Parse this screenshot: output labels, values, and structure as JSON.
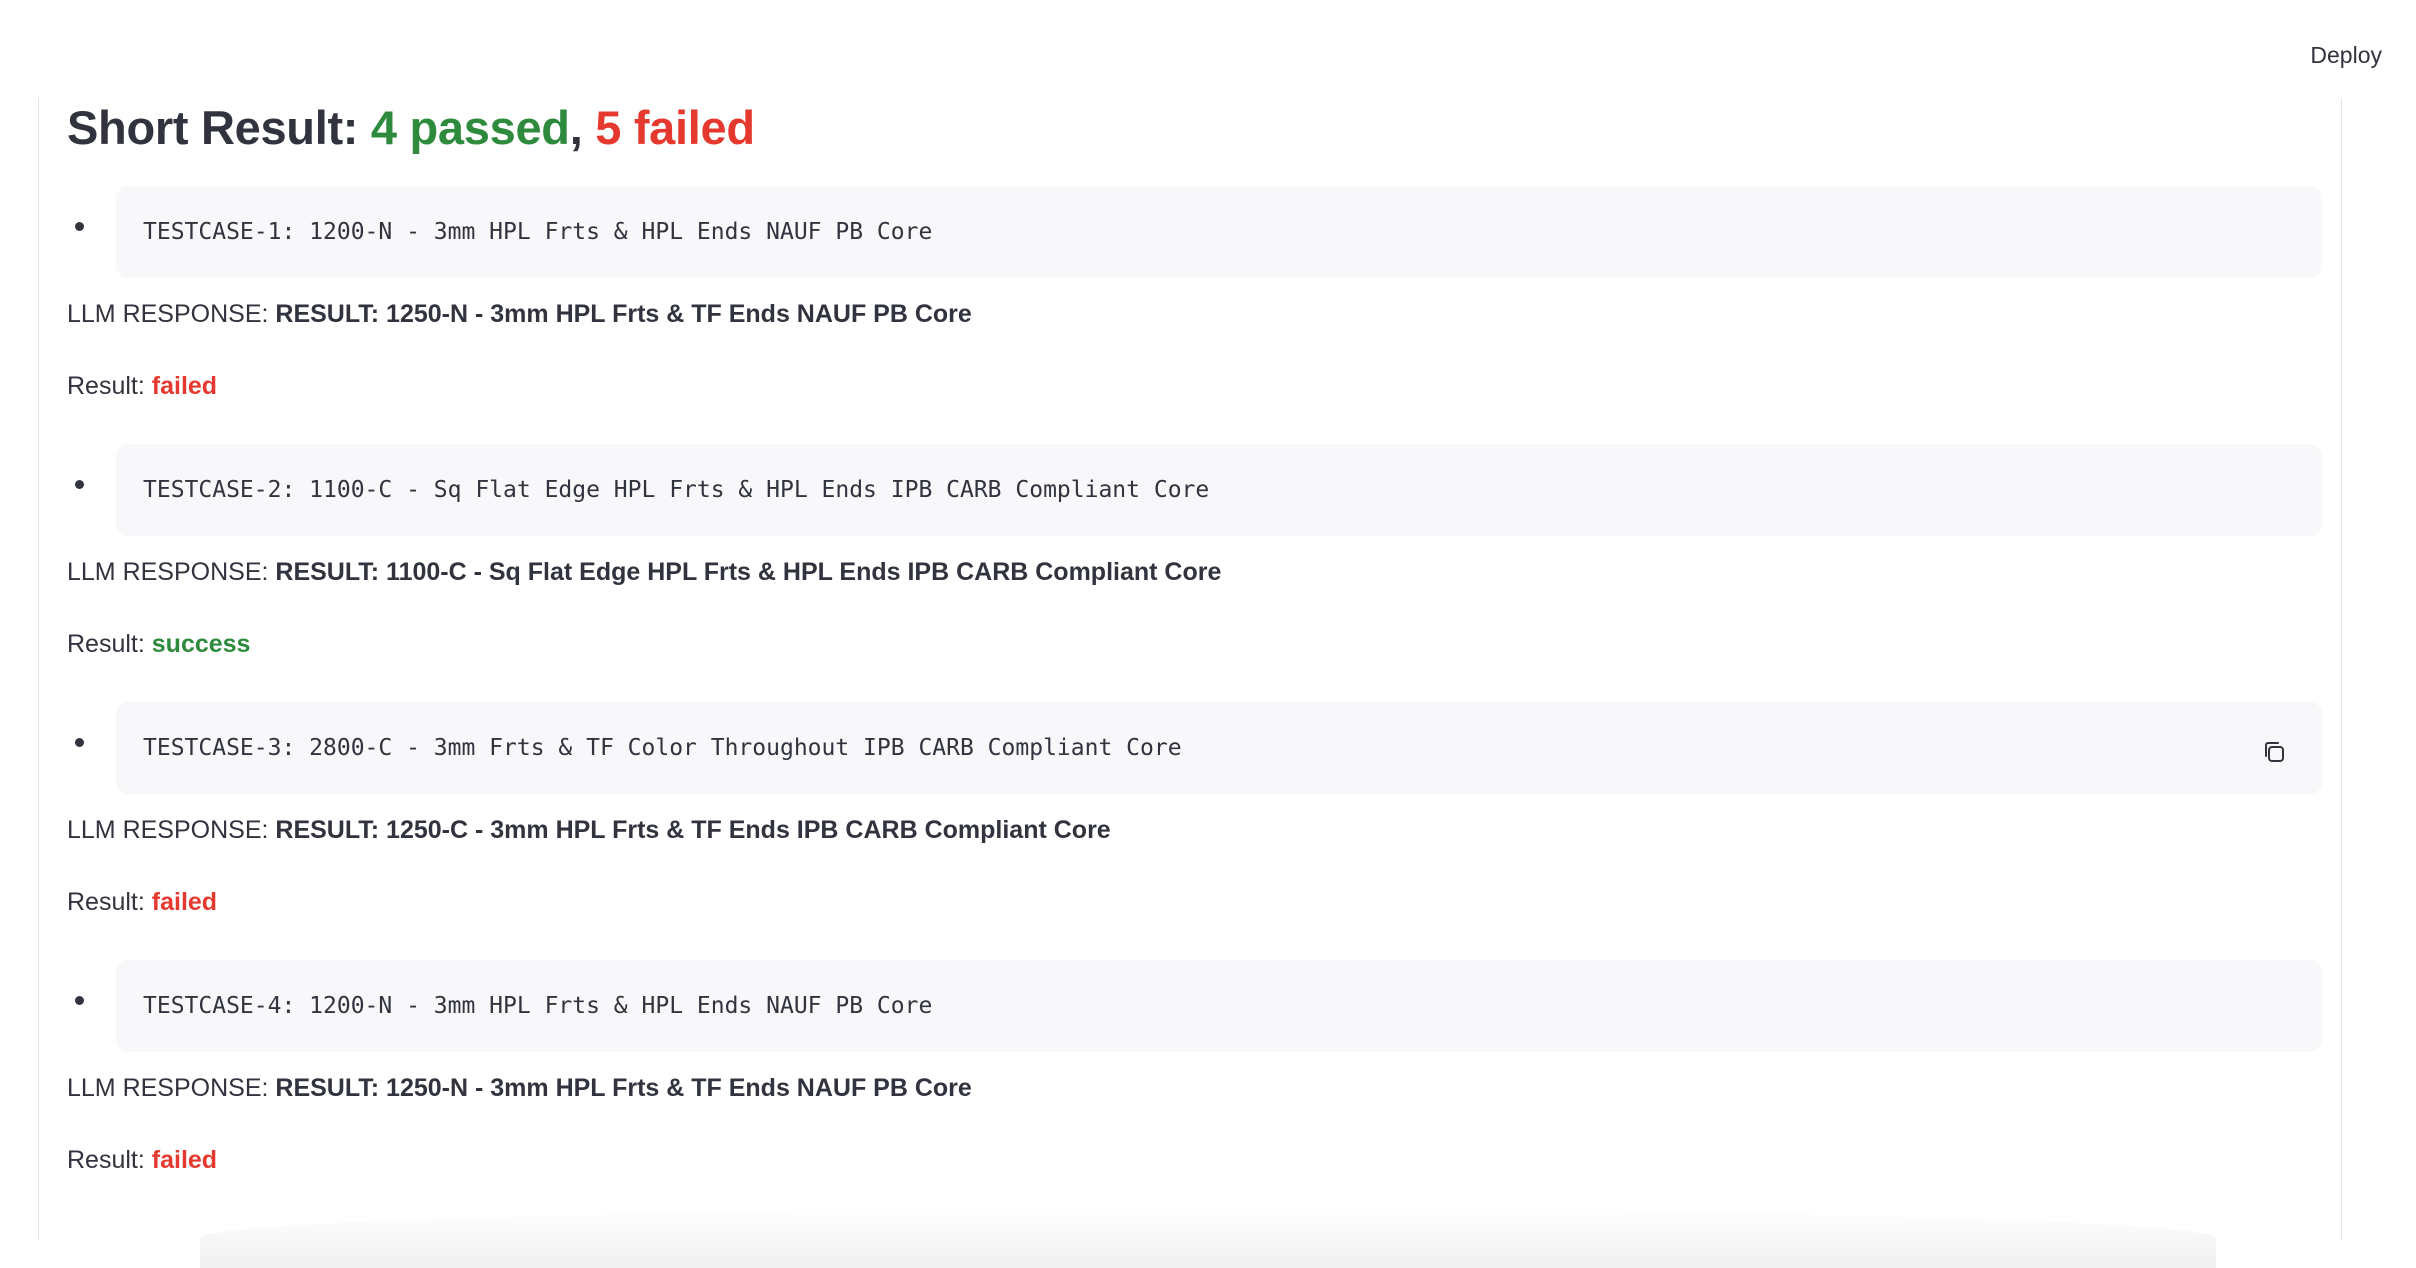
{
  "header": {
    "deploy_label": "Deploy"
  },
  "summary": {
    "prefix": "Short Result: ",
    "passed_text": "4 passed",
    "separator": ", ",
    "failed_text": "5 failed",
    "colors": {
      "passed": "#2e8b3d",
      "failed": "#e5392f"
    }
  },
  "labels": {
    "response_prefix": "LLM RESPONSE: ",
    "result_prefix": "Result: "
  },
  "cases": [
    {
      "code": "TESTCASE-1: 1200-N - 3mm HPL Frts & HPL Ends NAUF PB Core",
      "response": "RESULT: 1250-N - 3mm HPL Frts & TF Ends NAUF PB Core",
      "status": "failed"
    },
    {
      "code": "TESTCASE-2: 1100-C - Sq Flat Edge HPL Frts & HPL Ends IPB CARB Compliant Core",
      "response": "RESULT: 1100-C - Sq Flat Edge HPL Frts & HPL Ends IPB CARB Compliant Core",
      "status": "success"
    },
    {
      "code": "TESTCASE-3: 2800-C - 3mm Frts & TF Color Throughout IPB CARB Compliant Core",
      "response": "RESULT: 1250-C - 3mm HPL Frts & TF Ends IPB CARB Compliant Core",
      "status": "failed",
      "copy_icon": "copy-icon"
    },
    {
      "code": "TESTCASE-4: 1200-N - 3mm HPL Frts & HPL Ends NAUF PB Core",
      "response": "RESULT: 1250-N - 3mm HPL Frts & TF Ends NAUF PB Core",
      "status": "failed"
    }
  ]
}
